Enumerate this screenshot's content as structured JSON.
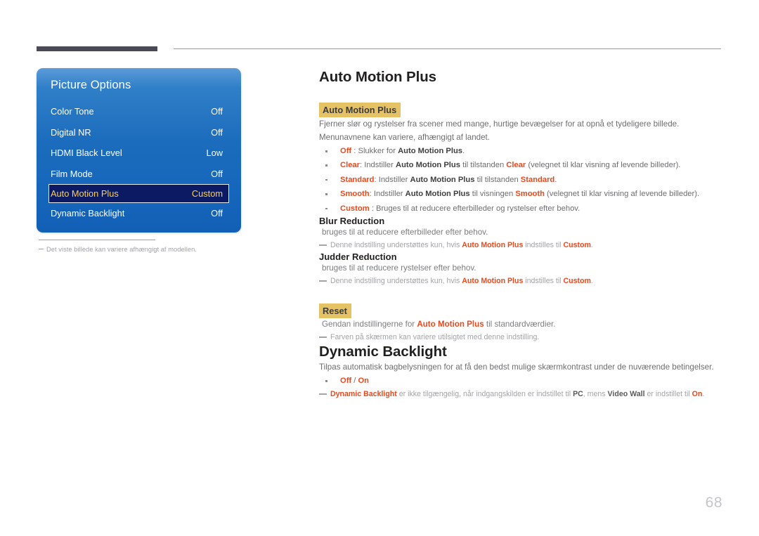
{
  "page": {
    "number": "68"
  },
  "osd": {
    "title": "Picture Options",
    "rows": [
      {
        "label": "Color Tone",
        "value": "Off",
        "selected": false
      },
      {
        "label": "Digital NR",
        "value": "Off",
        "selected": false
      },
      {
        "label": "HDMI Black Level",
        "value": "Low",
        "selected": false
      },
      {
        "label": "Film Mode",
        "value": "Off",
        "selected": false
      },
      {
        "label": "Auto Motion Plus",
        "value": "Custom",
        "selected": true
      },
      {
        "label": "Dynamic Backlight",
        "value": "Off",
        "selected": false
      }
    ],
    "note": "Det viste billede kan variere afhængigt af modellen."
  },
  "article": {
    "heading1": "Auto Motion Plus",
    "sub_highlight": "Auto Motion Plus",
    "intro_line1": "Fjerner slør og rystelser fra scener med mange, hurtige bevægelser for at opnå et tydeligere billede.",
    "intro_line2": "Menunavnene kan variere, afhængigt af landet.",
    "bullets": [
      {
        "term": "Off",
        "sep": " : ",
        "text_before": "Slukker for ",
        "emph": "Auto Motion Plus",
        "text_after": "."
      },
      {
        "term": "Clear",
        "sep": ": ",
        "text_before": "Indstiller ",
        "emph": "Auto Motion Plus",
        "mid": " til tilstanden ",
        "term2": "Clear",
        "text_after": " (velegnet til klar visning af levende billeder)."
      },
      {
        "term": "Standard",
        "sep": ": ",
        "text_before": "Indstiller ",
        "emph": "Auto Motion Plus",
        "mid": " til tilstanden ",
        "term2": "Standard",
        "text_after": "."
      },
      {
        "term": "Smooth",
        "sep": ": ",
        "text_before": "Indstiller ",
        "emph": "Auto Motion Plus",
        "mid": " til visningen ",
        "term2": "Smooth",
        "text_after": " (velegnet til klar visning af levende billeder)."
      },
      {
        "term": "Custom",
        "sep": " : ",
        "text_before": "Bruges til at reducere efterbilleder og rystelser efter behov.",
        "emph": "",
        "text_after": ""
      }
    ],
    "blur": {
      "heading": "Blur Reduction",
      "desc": "bruges til at reducere efterbilleder efter behov.",
      "note_a": "Denne indstilling understøttes kun, hvis ",
      "note_term1": "Auto Motion Plus",
      "note_b": " indstilles til ",
      "note_term2": "Custom",
      "note_c": "."
    },
    "judder": {
      "heading": "Judder Reduction",
      "desc": "bruges til at reducere rystelser efter behov.",
      "note_a": "Denne indstilling understøttes kun, hvis ",
      "note_term1": "Auto Motion Plus",
      "note_b": " indstilles til ",
      "note_term2": "Custom",
      "note_c": "."
    },
    "reset": {
      "highlight": "Reset",
      "desc_a": "Gendan indstillingerne for ",
      "desc_term": "Auto Motion Plus",
      "desc_b": " til standardværdier.",
      "note": "Farven på skærmen kan variere utilsigtet med denne indstilling."
    },
    "heading2": "Dynamic Backlight",
    "dyn_intro": "Tilpas automatisk bagbelysningen for at få den bedst mulige skærmkontrast under de nuværende betingelser.",
    "dyn_bullet_off": "Off",
    "dyn_bullet_slash": " / ",
    "dyn_bullet_on": "On",
    "dyn_note_term1": "Dynamic Backlight",
    "dyn_note_a": " er ikke tilgængelig, når indgangskilden er indstillet til ",
    "dyn_note_term2": "PC",
    "dyn_note_b": ", mens ",
    "dyn_note_term3": "Video Wall",
    "dyn_note_c": " er indstillet til ",
    "dyn_note_term4": "On",
    "dyn_note_d": "."
  }
}
